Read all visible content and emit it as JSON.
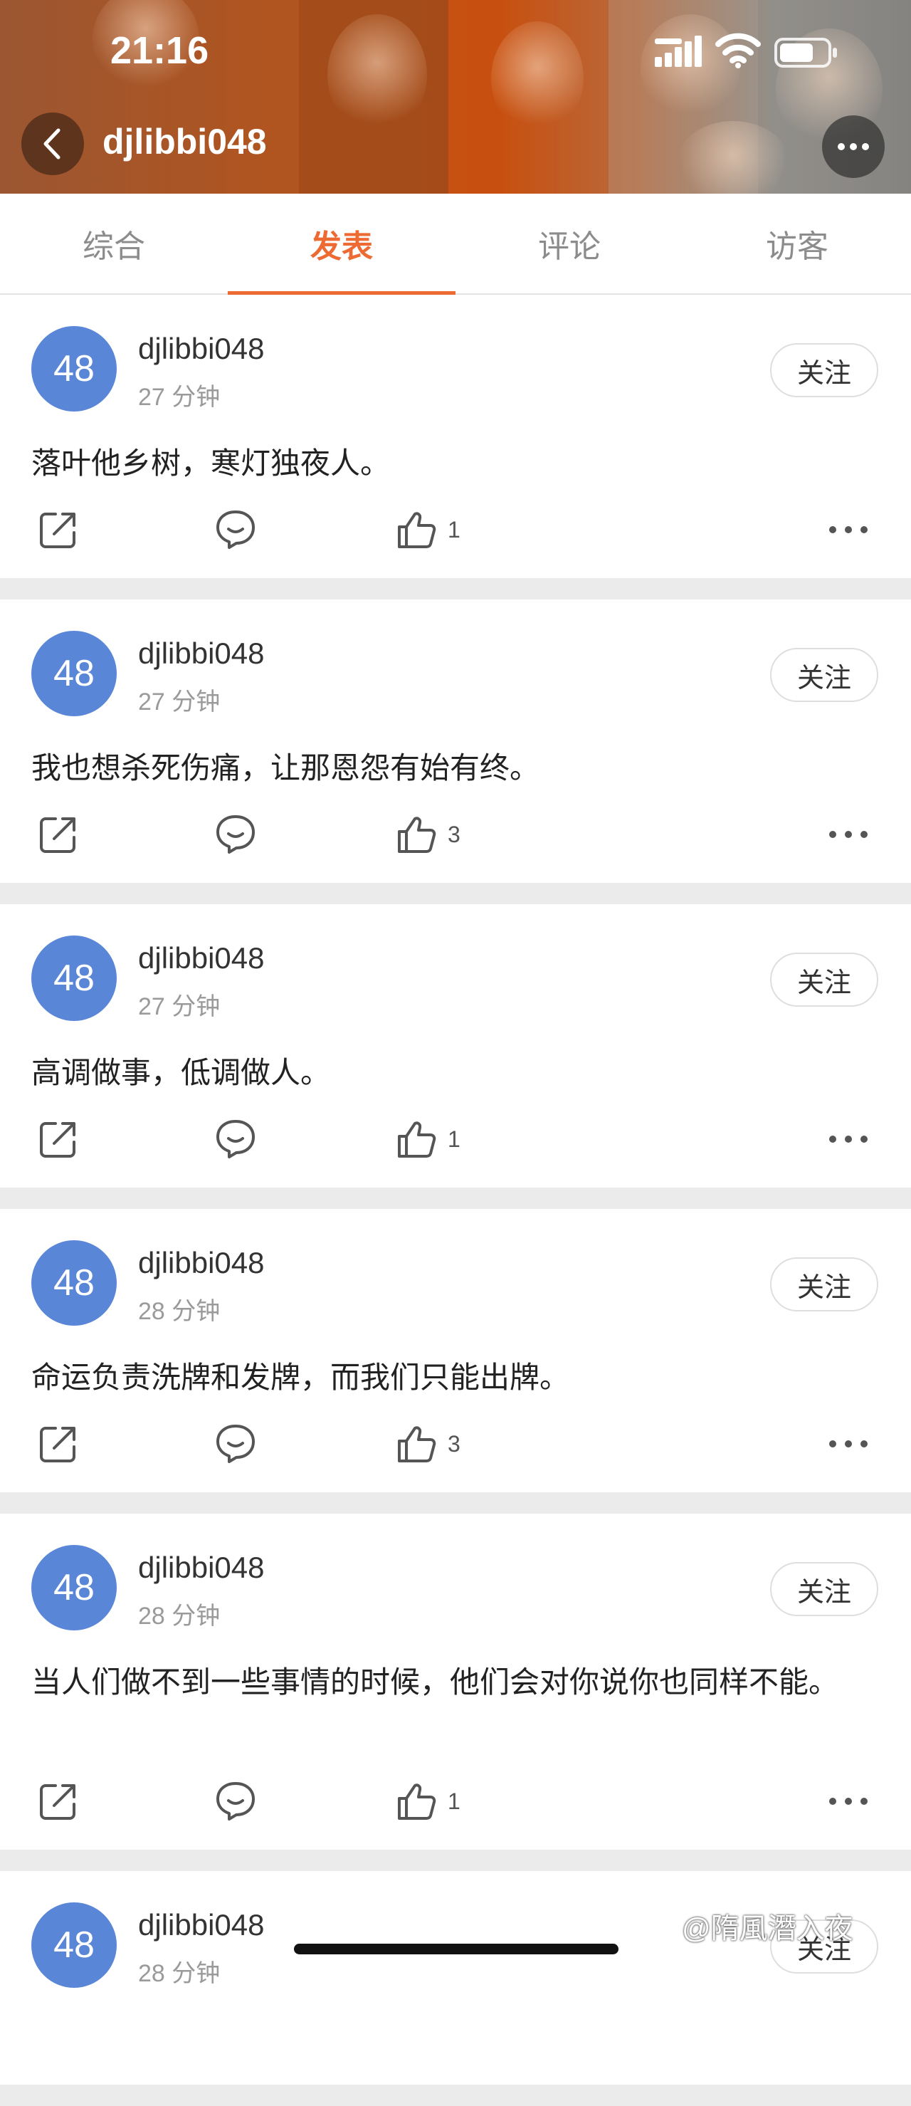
{
  "status_bar": {
    "time": "21:16"
  },
  "header": {
    "title": "djlibbi048"
  },
  "tabs": [
    {
      "label": "综合",
      "active": false
    },
    {
      "label": "发表",
      "active": true
    },
    {
      "label": "评论",
      "active": false
    },
    {
      "label": "访客",
      "active": false
    }
  ],
  "posts": [
    {
      "avatar_text": "48",
      "username": "djlibbi048",
      "time": "27 分钟",
      "follow_label": "关注",
      "content": "落叶他乡树，寒灯独夜人。",
      "likes": "1"
    },
    {
      "avatar_text": "48",
      "username": "djlibbi048",
      "time": "27 分钟",
      "follow_label": "关注",
      "content": "我也想杀死伤痛，让那恩怨有始有终。",
      "likes": "3"
    },
    {
      "avatar_text": "48",
      "username": "djlibbi048",
      "time": "27 分钟",
      "follow_label": "关注",
      "content": "高调做事，低调做人。",
      "likes": "1"
    },
    {
      "avatar_text": "48",
      "username": "djlibbi048",
      "time": "28 分钟",
      "follow_label": "关注",
      "content": "命运负责洗牌和发牌，而我们只能出牌。",
      "likes": "3"
    },
    {
      "avatar_text": "48",
      "username": "djlibbi048",
      "time": "28 分钟",
      "follow_label": "关注",
      "content": "当人们做不到一些事情的时候，他们会对你说你也同样不能。",
      "likes": "1"
    },
    {
      "avatar_text": "48",
      "username": "djlibbi048",
      "time": "28 分钟",
      "follow_label": "关注",
      "content": "",
      "likes": ""
    }
  ],
  "watermark": "@隋風潛入夜",
  "colors": {
    "accent": "#ee6a33",
    "avatar": "#5a86d8"
  }
}
